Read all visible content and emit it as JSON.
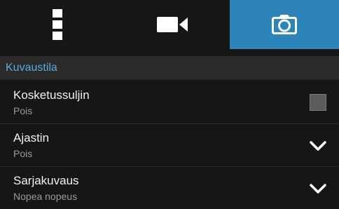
{
  "tabs": {
    "menu_icon": "vertical-menu-icon",
    "video_icon": "video-camera-icon",
    "photo_icon": "camera-icon",
    "active_color": "#2d84b8"
  },
  "section": {
    "title": "Kuvaustila",
    "title_color": "#5aa9e0"
  },
  "settings": [
    {
      "title": "Kosketussuljin",
      "value": "Pois",
      "control": "checkbox",
      "checked": false
    },
    {
      "title": "Ajastin",
      "value": "Pois",
      "control": "dropdown"
    },
    {
      "title": "Sarjakuvaus",
      "value": "Nopea nopeus",
      "control": "dropdown"
    }
  ]
}
